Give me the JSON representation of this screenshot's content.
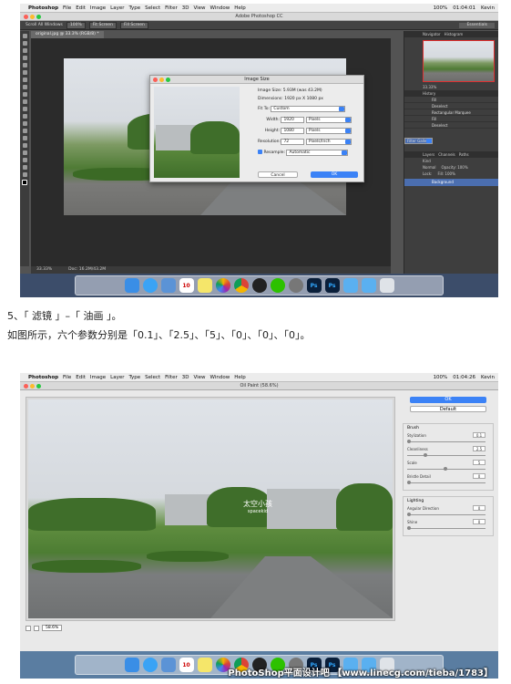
{
  "shot1": {
    "menubar": {
      "items": [
        "Photoshop",
        "File",
        "Edit",
        "Image",
        "Layer",
        "Type",
        "Select",
        "Filter",
        "3D",
        "View",
        "Window",
        "Help"
      ],
      "clock": "01:04:01",
      "user": "Kevin",
      "battery": "100%"
    },
    "app_title": "Adobe Photoshop CC",
    "options": {
      "scroll_all": "Scroll All Windows",
      "zoom_100": "100%",
      "fit_screen": "Fit Screen",
      "fill_screen": "Fill Screen",
      "workspace": "Essentials"
    },
    "doc_tab": "original.jpg @ 33.3% (RGB/8) *",
    "status": {
      "zoom": "33.33%",
      "doc": "Doc: 16.2M/43.2M"
    },
    "panels": {
      "nav_tabs": [
        "Navigator",
        "Histogram"
      ],
      "nav_zoom": "33.33%",
      "history_title": "History",
      "history": [
        "Fill",
        "Deselect",
        "Rectangular Marquee",
        "Fill",
        "Deselect",
        "Filter Gallery"
      ],
      "layer_tabs": [
        "Layers",
        "Channels",
        "Paths"
      ],
      "layer_kind": "Kind",
      "blend": "Normal",
      "opacity": "Opacity: 100%",
      "lock": "Lock:",
      "fill": "Fill: 100%",
      "layer_name": "Background"
    },
    "image_size": {
      "title": "Image Size",
      "image_size_label": "Image Size:",
      "image_size_value": "5.93M (was 43.2M)",
      "dimensions_label": "Dimensions:",
      "dimensions_value": "1920 px  X  1080 px",
      "fit_label": "Fit To:",
      "fit_value": "Custom",
      "width_label": "Width:",
      "width_value": "1920",
      "width_unit": "Pixels",
      "height_label": "Height:",
      "height_value": "1080",
      "height_unit": "Pixels",
      "resolution_label": "Resolution:",
      "resolution_value": "72",
      "resolution_unit": "Pixels/Inch",
      "resample_label": "Resample:",
      "resample_value": "Automatic",
      "cancel": "Cancel",
      "ok": "OK"
    }
  },
  "caption1": "5、「 滤镜 」–「 油画 」。",
  "caption2": "如图所示，六个参数分别是「0.1」、「2.5」、「5」、「0」、「0」、「0」。",
  "shot2": {
    "menubar": {
      "items": [
        "Photoshop",
        "File",
        "Edit",
        "Image",
        "Layer",
        "Type",
        "Select",
        "Filter",
        "3D",
        "View",
        "Window",
        "Help"
      ],
      "clock": "01:04:26",
      "user": "Kevin",
      "battery": "100%"
    },
    "dialog_title": "Oil Paint (58.6%)",
    "zoom_value": "58.6%",
    "ok": "OK",
    "default": "Default",
    "brush_title": "Brush",
    "brush_params": [
      {
        "label": "Stylization",
        "value": "0.1"
      },
      {
        "label": "Cleanliness",
        "value": "2.5"
      },
      {
        "label": "Scale",
        "value": "5"
      },
      {
        "label": "Bristle Detail",
        "value": "0"
      }
    ],
    "lighting_title": "Lighting",
    "lighting_params": [
      {
        "label": "Angular Direction",
        "value": "0"
      },
      {
        "label": "Shine",
        "value": "0"
      }
    ]
  },
  "photo_watermark": "太空小孩",
  "photo_watermark_sub": "spacekid",
  "page_watermark": "PhotoShop平面设计吧 【www.linecg.com/tieba/1783】",
  "dock_icons": [
    "finder-icon",
    "messages-icon",
    "mail-icon",
    "calendar-icon",
    "notes-icon",
    "photos-icon",
    "chrome-icon",
    "qq-icon",
    "wechat-icon",
    "settings-icon",
    "photoshop-icon",
    "photoshop-icon",
    "folder-icon",
    "downloads-icon",
    "trash-icon"
  ],
  "dock_calendar_day": "10",
  "dock_ps_label": "Ps"
}
